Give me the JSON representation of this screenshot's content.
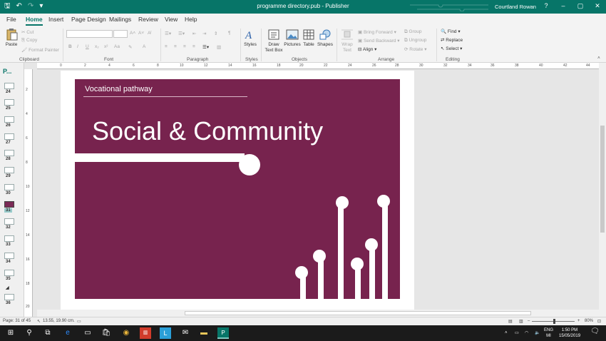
{
  "titlebar": {
    "title": "programme directory.pub - Publisher",
    "user": "Courtland Rowan",
    "help": "?",
    "minimize": "–",
    "maximize": "▢",
    "close": "✕"
  },
  "tabs": [
    "File",
    "Home",
    "Insert",
    "Page Design",
    "Mailings",
    "Review",
    "View",
    "Help"
  ],
  "ribbon": {
    "clipboard": {
      "paste": "Paste",
      "cut": "Cut",
      "copy": "Copy",
      "format_painter": "Format Painter",
      "group": "Clipboard"
    },
    "font": {
      "group": "Font",
      "bold": "B",
      "italic": "I",
      "underline": "U",
      "sub": "x₂",
      "sup": "x²",
      "aa": "Aa",
      "a": "A"
    },
    "paragraph": {
      "group": "Paragraph",
      "pilcrow": "¶"
    },
    "styles": {
      "label": "Styles",
      "group": "Styles"
    },
    "objects": {
      "draw_text_box": "Draw Text Box",
      "pictures": "Pictures",
      "table": "Table",
      "shapes": "Shapes",
      "group": "Objects"
    },
    "arrange": {
      "wrap_text": "Wrap Text",
      "bring_forward": "Bring Forward",
      "send_backward": "Send Backward",
      "align": "Align",
      "group_btn": "Group",
      "ungroup": "Ungroup",
      "rotate": "Rotate",
      "group": "Arrange"
    },
    "editing": {
      "find": "Find",
      "replace": "Replace",
      "select": "Select",
      "group": "Editing"
    }
  },
  "pages_panel": {
    "title": "P...",
    "pages": [
      "24",
      "25",
      "26",
      "27",
      "28",
      "29",
      "30",
      "31",
      "32",
      "33",
      "34",
      "35",
      "36"
    ],
    "selected": "31"
  },
  "hruler": [
    "0",
    "2",
    "4",
    "6",
    "8",
    "10",
    "12",
    "14",
    "16",
    "18",
    "20",
    "22",
    "24",
    "26",
    "28",
    "30",
    "32",
    "34",
    "36",
    "38",
    "40",
    "42",
    "44"
  ],
  "vruler": [
    "2",
    "4",
    "6",
    "8",
    "10",
    "12",
    "14",
    "16",
    "18",
    "20"
  ],
  "slide": {
    "subtitle": "Vocational pathway",
    "title": "Social & Community",
    "bg_color": "#77234e"
  },
  "status": {
    "page": "Page: 31 of 45",
    "position": "13.55, 19.90 cm.",
    "zoom": "80%"
  },
  "taskbar": {
    "lang1": "ENG",
    "lang2": "MI",
    "time": "1:50 PM",
    "date": "15/05/2019"
  }
}
